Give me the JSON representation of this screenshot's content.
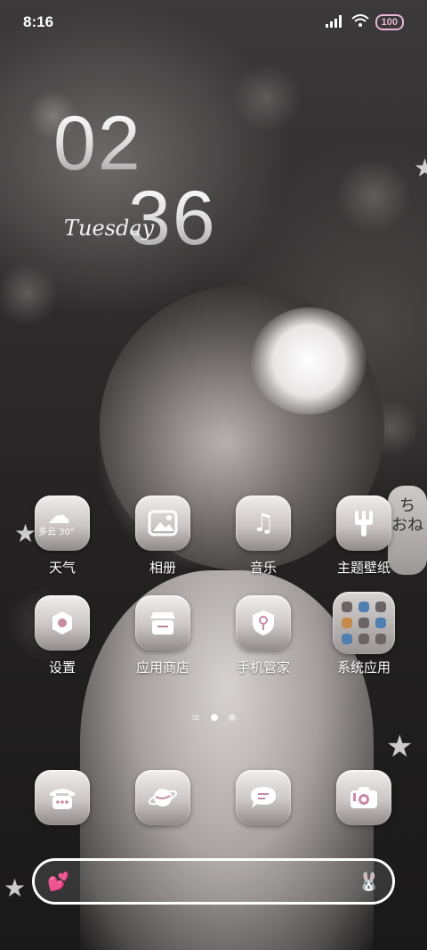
{
  "status_bar": {
    "time": "8:16",
    "battery": "100"
  },
  "clock": {
    "hours": "02",
    "minutes": "36",
    "day": "Tuesday"
  },
  "wallpaper": {
    "lantern_text": "ち\nおね"
  },
  "apps_row1": [
    {
      "label": "天气",
      "icon": "weather-icon",
      "weather_text": "多云 30°"
    },
    {
      "label": "相册",
      "icon": "gallery-icon"
    },
    {
      "label": "音乐",
      "icon": "music-icon"
    },
    {
      "label": "主题壁纸",
      "icon": "theme-icon"
    }
  ],
  "apps_row2": [
    {
      "label": "设置",
      "icon": "settings-icon"
    },
    {
      "label": "应用商店",
      "icon": "app-store-icon"
    },
    {
      "label": "手机管家",
      "icon": "phone-manager-icon"
    },
    {
      "label": "系统应用",
      "icon": "folder-icon"
    }
  ],
  "dock": [
    {
      "icon": "phone-icon"
    },
    {
      "icon": "browser-icon"
    },
    {
      "icon": "messages-icon"
    },
    {
      "icon": "camera-icon"
    }
  ],
  "colors": {
    "battery": "#e7b6d6",
    "search_heart": "#f3a7c8"
  }
}
